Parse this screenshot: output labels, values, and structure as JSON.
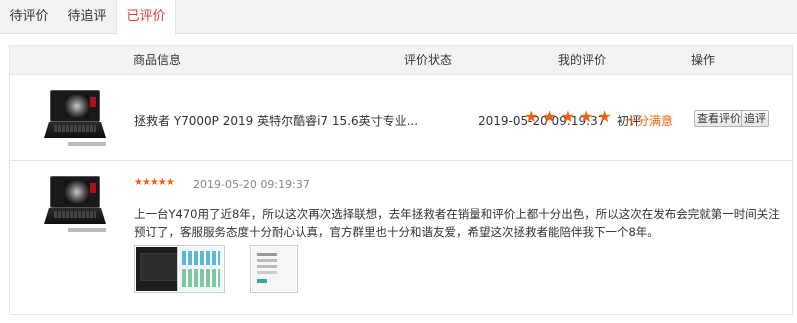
{
  "tabs": [
    {
      "label": "待评价"
    },
    {
      "label": "待追评"
    },
    {
      "label": "已评价"
    }
  ],
  "table": {
    "headers": [
      "商品信息",
      "评价状态",
      "我的评价",
      "操作"
    ]
  },
  "order": {
    "product_name": "拯救者 Y7000P 2019 英特尔酷睿i7 15.6英寸专业...",
    "datetime": "2019-05-20 09:19:37",
    "status": "初评",
    "rating_stars": 5,
    "satisfaction": "十分满意",
    "actions": {
      "view": "查看评价",
      "follow_up": "追评"
    }
  },
  "review": {
    "rating_stars": 5,
    "time": "2019-05-20 09:19:37",
    "text": "上一台Y470用了近8年，所以这次再次选择联想，去年拯救者在销量和评价上都十分出色，所以这次在发布会完就第一时间关注预订了，客服服务态度十分耐心认真，官方群里也十分和谐友爱，希望这次拯救者能陪伴我下一个8年。",
    "photos": [
      "laptop-photo",
      "screenshot-photo",
      "document-photo"
    ]
  },
  "colors": {
    "accent": "#e4393c",
    "star": "#f5620b"
  }
}
